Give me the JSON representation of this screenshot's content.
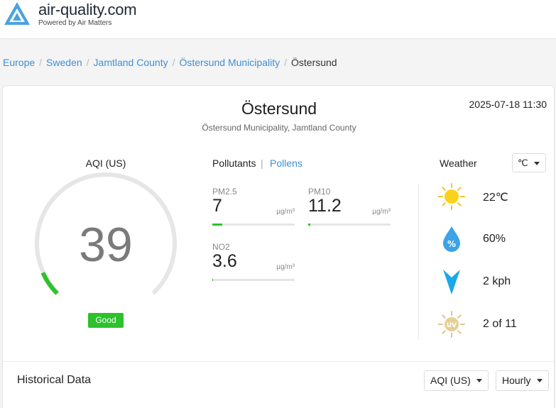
{
  "header": {
    "site_title": "air-quality.com",
    "site_subtitle": "Powered by Air Matters",
    "logo_icon": "air-quality-logo",
    "brand_color": "#4aa3df"
  },
  "breadcrumb": {
    "items": [
      "Europe",
      "Sweden",
      "Jamtland County",
      "Östersund Municipality"
    ],
    "separator": "/",
    "current": "Östersund"
  },
  "location": {
    "city": "Östersund",
    "region": "Östersund Municipality, Jamtland County",
    "datetime": "2025-07-18 11:30"
  },
  "aqi": {
    "label": "AQI (US)",
    "value": "39",
    "level": 0.078,
    "status": "Good",
    "status_color": "#2dc12d"
  },
  "pollutant_tabs": {
    "active": "Pollutants",
    "separator": "|",
    "other": "Pollens"
  },
  "pollutants": [
    {
      "name": "PM2.5",
      "value": "7",
      "unit": "µg/m³",
      "level": 0.12
    },
    {
      "name": "PM10",
      "value": "11.2",
      "unit": "µg/m³",
      "level": 0.03
    },
    {
      "name": "NO2",
      "value": "3.6",
      "unit": "µg/m³",
      "level": 0.01
    }
  ],
  "weather": {
    "label": "Weather",
    "unit": "℃",
    "items": [
      {
        "icon": "sun-icon",
        "value": "22℃"
      },
      {
        "icon": "humidity-icon",
        "value": "60%"
      },
      {
        "icon": "wind-icon",
        "value": "2 kph"
      },
      {
        "icon": "uv-icon",
        "value": "2 of 11"
      }
    ]
  },
  "historical": {
    "title": "Historical Data",
    "metric": "AQI (US)",
    "interval": "Hourly"
  }
}
